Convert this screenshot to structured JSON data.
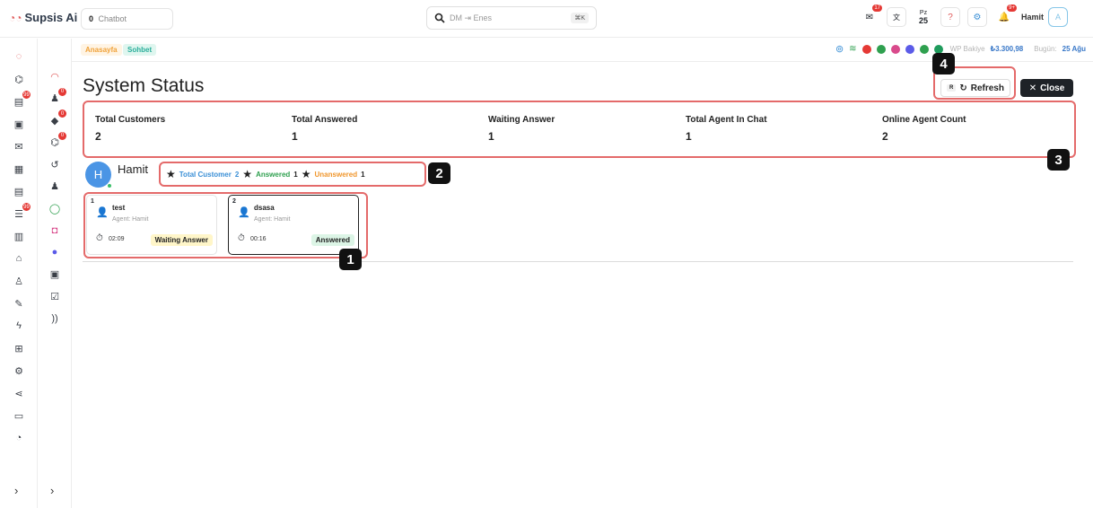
{
  "topbar": {
    "logo": "Supsis Ai",
    "chatbot_count": "0",
    "chatbot_label": "Chatbot",
    "search_placeholder": "DM ⇥ Enes",
    "search_shortcut": "⌘K",
    "mail_badge": "17",
    "calendar_day_abbr": "Pz",
    "calendar_day": "25",
    "help_label": "?",
    "bell_badge": "9+",
    "user_name": "Hamit",
    "user_initial": "A"
  },
  "rail_primary": [
    {
      "icon": "logo-mark-icon"
    },
    {
      "icon": "robot-icon"
    },
    {
      "icon": "chat-bubbles-icon",
      "badge": "99"
    },
    {
      "icon": "id-card-icon"
    },
    {
      "icon": "envelope-icon"
    },
    {
      "icon": "calendar-icon"
    },
    {
      "icon": "document-icon"
    },
    {
      "icon": "tasks-icon",
      "badge": "99"
    },
    {
      "icon": "kanban-icon"
    },
    {
      "icon": "inbox-icon"
    },
    {
      "icon": "contacts-icon"
    },
    {
      "icon": "edit-icon"
    },
    {
      "icon": "bolt-icon"
    },
    {
      "icon": "apps-grid-icon"
    },
    {
      "icon": "settings-icon"
    },
    {
      "icon": "share-icon"
    },
    {
      "icon": "payment-icon"
    },
    {
      "icon": "pie-chart-icon"
    }
  ],
  "rail_secondary": [
    {
      "icon": "headset-icon"
    },
    {
      "icon": "user-plus-icon",
      "badge": "0"
    },
    {
      "icon": "tag-icon",
      "badge": "0"
    },
    {
      "icon": "robot-badge-icon",
      "badge": "0"
    },
    {
      "icon": "history-icon"
    },
    {
      "icon": "user-settings-icon"
    },
    {
      "icon": "whatsapp-icon"
    },
    {
      "icon": "instagram-icon"
    },
    {
      "icon": "messenger-icon"
    },
    {
      "icon": "calendar-small-icon"
    },
    {
      "icon": "calendar-check-icon"
    },
    {
      "icon": "rss-icon"
    }
  ],
  "breadcrumb": {
    "home": "Anasayfa",
    "chat": "Sohbet",
    "wp_balance_label": "WP Bakiye",
    "wp_balance": "₺3.300,98",
    "today_label": "Bugün:",
    "today_value": "25 Ağu"
  },
  "page": {
    "title": "System Status",
    "refresh_key": "R",
    "refresh_label": "Refresh",
    "close_label": "Close"
  },
  "stats": [
    {
      "label": "Total Customers",
      "value": "2"
    },
    {
      "label": "Total Answered",
      "value": "1"
    },
    {
      "label": "Waiting Answer",
      "value": "1"
    },
    {
      "label": "Total Agent In Chat",
      "value": "1"
    },
    {
      "label": "Online Agent Count",
      "value": "2"
    }
  ],
  "agent": {
    "initial": "H",
    "name": "Hamit",
    "total_customer_label": "Total Customer",
    "total_customer_value": "2",
    "answered_label": "Answered",
    "answered_value": "1",
    "unanswered_label": "Unanswered",
    "unanswered_value": "1"
  },
  "chats": [
    {
      "index": "1",
      "customer": "test",
      "agent": "Agent: Hamit",
      "time": "02:09",
      "status": "Waiting Answer"
    },
    {
      "index": "2",
      "customer": "dsasa",
      "agent": "Agent: Hamit",
      "time": "00:16",
      "status": "Answered"
    }
  ],
  "callouts": [
    "1",
    "2",
    "3",
    "4"
  ],
  "colors": {
    "total_customer": "#3a8fd6",
    "answered": "#2fa04f",
    "unanswered": "#f0962c",
    "callout": "#e46a6a"
  }
}
